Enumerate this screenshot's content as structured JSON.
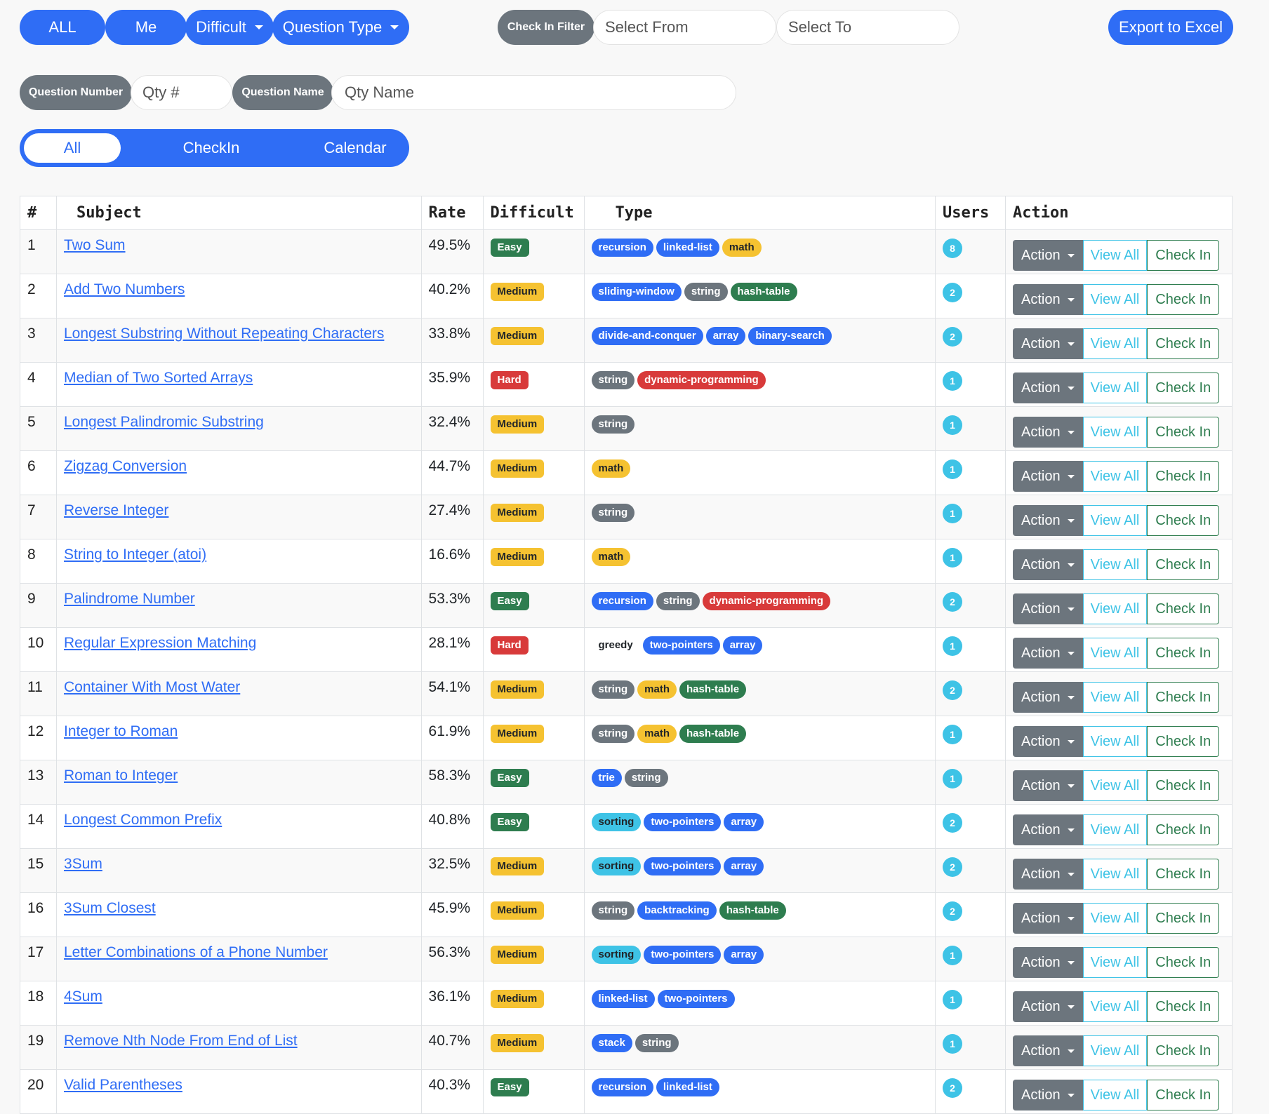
{
  "toolbar": {
    "all_label": "ALL",
    "me_label": "Me",
    "difficult_label": "Difficult",
    "question_type_label": "Question Type",
    "checkin_filter_label": "Check In Filter",
    "select_from_placeholder": "Select From",
    "select_to_placeholder": "Select To",
    "export_label": "Export to Excel"
  },
  "search": {
    "question_number_label": "Question Number",
    "qty_number_placeholder": "Qty #",
    "question_name_label": "Question Name",
    "qty_name_placeholder": "Qty Name"
  },
  "view_tabs": [
    "All",
    "CheckIn",
    "Calendar"
  ],
  "table": {
    "headers": [
      "#",
      "Subject",
      "Rate",
      "Difficult",
      "Type",
      "Users",
      "Action"
    ],
    "action_label": "Action",
    "view_all_label": "View All",
    "check_in_label": "Check In",
    "rows": [
      {
        "n": "1",
        "subject": "Two Sum",
        "rate": "49.5%",
        "difficulty": "Easy",
        "tags": [
          {
            "t": "recursion",
            "c": "blue"
          },
          {
            "t": "linked-list",
            "c": "blue"
          },
          {
            "t": "math",
            "c": "yellow"
          }
        ],
        "users": "8"
      },
      {
        "n": "2",
        "subject": "Add Two Numbers",
        "rate": "40.2%",
        "difficulty": "Medium",
        "tags": [
          {
            "t": "sliding-window",
            "c": "blue"
          },
          {
            "t": "string",
            "c": "grey"
          },
          {
            "t": "hash-table",
            "c": "green"
          }
        ],
        "users": "2"
      },
      {
        "n": "3",
        "subject": "Longest Substring Without Repeating Characters",
        "rate": "33.8%",
        "difficulty": "Medium",
        "tags": [
          {
            "t": "divide-and-conquer",
            "c": "blue"
          },
          {
            "t": "array",
            "c": "blue"
          },
          {
            "t": "binary-search",
            "c": "blue"
          }
        ],
        "users": "2"
      },
      {
        "n": "4",
        "subject": "Median of Two Sorted Arrays",
        "rate": "35.9%",
        "difficulty": "Hard",
        "tags": [
          {
            "t": "string",
            "c": "grey"
          },
          {
            "t": "dynamic-programming",
            "c": "red"
          }
        ],
        "users": "1"
      },
      {
        "n": "5",
        "subject": "Longest Palindromic Substring",
        "rate": "32.4%",
        "difficulty": "Medium",
        "tags": [
          {
            "t": "string",
            "c": "grey"
          }
        ],
        "users": "1"
      },
      {
        "n": "6",
        "subject": "Zigzag Conversion",
        "rate": "44.7%",
        "difficulty": "Medium",
        "tags": [
          {
            "t": "math",
            "c": "yellow"
          }
        ],
        "users": "1"
      },
      {
        "n": "7",
        "subject": "Reverse Integer",
        "rate": "27.4%",
        "difficulty": "Medium",
        "tags": [
          {
            "t": "string",
            "c": "grey"
          }
        ],
        "users": "1"
      },
      {
        "n": "8",
        "subject": "String to Integer (atoi)",
        "rate": "16.6%",
        "difficulty": "Medium",
        "tags": [
          {
            "t": "math",
            "c": "yellow"
          }
        ],
        "users": "1"
      },
      {
        "n": "9",
        "subject": "Palindrome Number",
        "rate": "53.3%",
        "difficulty": "Easy",
        "tags": [
          {
            "t": "recursion",
            "c": "blue"
          },
          {
            "t": "string",
            "c": "grey"
          },
          {
            "t": "dynamic-programming",
            "c": "red"
          }
        ],
        "users": "2"
      },
      {
        "n": "10",
        "subject": "Regular Expression Matching",
        "rate": "28.1%",
        "difficulty": "Hard",
        "tags": [
          {
            "t": "greedy",
            "c": "plain"
          },
          {
            "t": "two-pointers",
            "c": "blue"
          },
          {
            "t": "array",
            "c": "blue"
          }
        ],
        "users": "1"
      },
      {
        "n": "11",
        "subject": "Container With Most Water",
        "rate": "54.1%",
        "difficulty": "Medium",
        "tags": [
          {
            "t": "string",
            "c": "grey"
          },
          {
            "t": "math",
            "c": "yellow"
          },
          {
            "t": "hash-table",
            "c": "green"
          }
        ],
        "users": "2"
      },
      {
        "n": "12",
        "subject": "Integer to Roman",
        "rate": "61.9%",
        "difficulty": "Medium",
        "tags": [
          {
            "t": "string",
            "c": "grey"
          },
          {
            "t": "math",
            "c": "yellow"
          },
          {
            "t": "hash-table",
            "c": "green"
          }
        ],
        "users": "1"
      },
      {
        "n": "13",
        "subject": "Roman to Integer",
        "rate": "58.3%",
        "difficulty": "Easy",
        "tags": [
          {
            "t": "trie",
            "c": "blue"
          },
          {
            "t": "string",
            "c": "grey"
          }
        ],
        "users": "1"
      },
      {
        "n": "14",
        "subject": "Longest Common Prefix",
        "rate": "40.8%",
        "difficulty": "Easy",
        "tags": [
          {
            "t": "sorting",
            "c": "cyan"
          },
          {
            "t": "two-pointers",
            "c": "blue"
          },
          {
            "t": "array",
            "c": "blue"
          }
        ],
        "users": "2"
      },
      {
        "n": "15",
        "subject": "3Sum",
        "rate": "32.5%",
        "difficulty": "Medium",
        "tags": [
          {
            "t": "sorting",
            "c": "cyan"
          },
          {
            "t": "two-pointers",
            "c": "blue"
          },
          {
            "t": "array",
            "c": "blue"
          }
        ],
        "users": "2"
      },
      {
        "n": "16",
        "subject": "3Sum Closest",
        "rate": "45.9%",
        "difficulty": "Medium",
        "tags": [
          {
            "t": "string",
            "c": "grey"
          },
          {
            "t": "backtracking",
            "c": "blue"
          },
          {
            "t": "hash-table",
            "c": "green"
          }
        ],
        "users": "2"
      },
      {
        "n": "17",
        "subject": "Letter Combinations of a Phone Number",
        "rate": "56.3%",
        "difficulty": "Medium",
        "tags": [
          {
            "t": "sorting",
            "c": "cyan"
          },
          {
            "t": "two-pointers",
            "c": "blue"
          },
          {
            "t": "array",
            "c": "blue"
          }
        ],
        "users": "1"
      },
      {
        "n": "18",
        "subject": "4Sum",
        "rate": "36.1%",
        "difficulty": "Medium",
        "tags": [
          {
            "t": "linked-list",
            "c": "blue"
          },
          {
            "t": "two-pointers",
            "c": "blue"
          }
        ],
        "users": "1"
      },
      {
        "n": "19",
        "subject": "Remove Nth Node From End of List",
        "rate": "40.7%",
        "difficulty": "Medium",
        "tags": [
          {
            "t": "stack",
            "c": "blue"
          },
          {
            "t": "string",
            "c": "grey"
          }
        ],
        "users": "1"
      },
      {
        "n": "20",
        "subject": "Valid Parentheses",
        "rate": "40.3%",
        "difficulty": "Easy",
        "tags": [
          {
            "t": "recursion",
            "c": "blue"
          },
          {
            "t": "linked-list",
            "c": "blue"
          }
        ],
        "users": "2"
      }
    ]
  }
}
